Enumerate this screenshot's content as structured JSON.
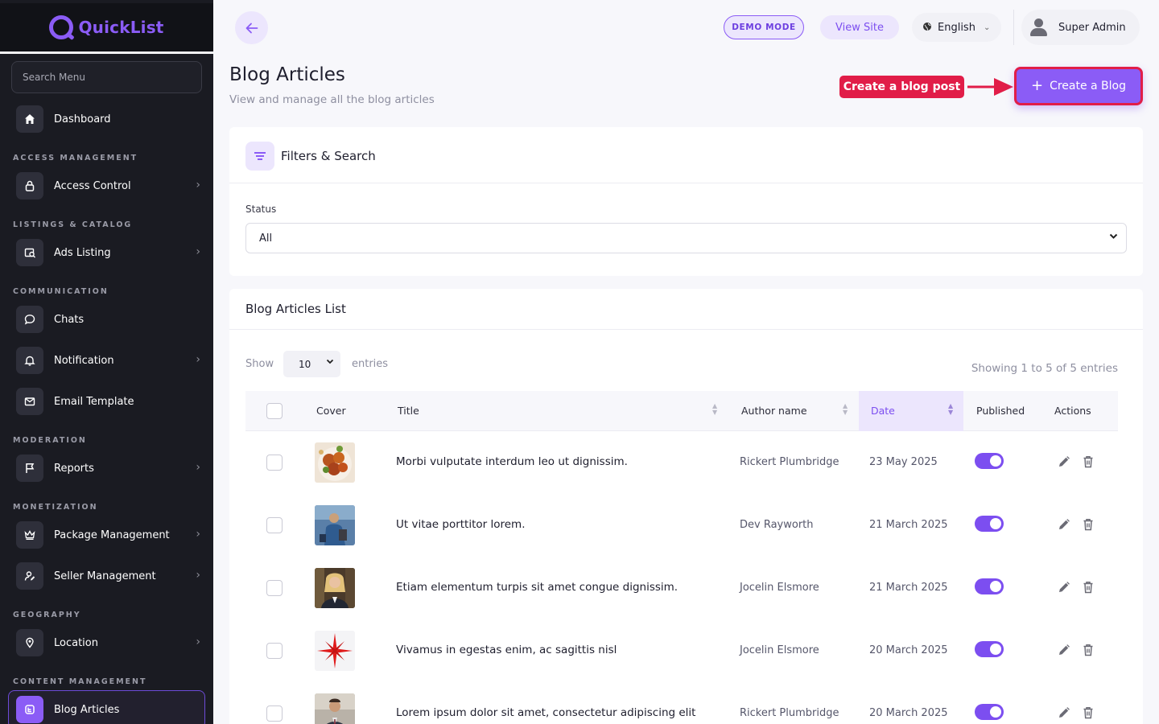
{
  "brand": {
    "name": "QuickList",
    "accent": "#8b5cf6"
  },
  "sidebar": {
    "search_placeholder": "Search Menu",
    "items": [
      {
        "label": "Dashboard",
        "icon": "home-icon"
      },
      {
        "section": "ACCESS MANAGEMENT"
      },
      {
        "label": "Access Control",
        "icon": "lock-icon"
      },
      {
        "section": "LISTINGS & CATALOG"
      },
      {
        "label": "Ads Listing",
        "icon": "ad-search-icon"
      },
      {
        "section": "COMMUNICATION"
      },
      {
        "label": "Chats",
        "icon": "chat-icon"
      },
      {
        "label": "Notification",
        "icon": "bell-icon"
      },
      {
        "label": "Email Template",
        "icon": "mail-icon"
      },
      {
        "section": "MODERATION"
      },
      {
        "label": "Reports",
        "icon": "flag-icon"
      },
      {
        "section": "MONETIZATION"
      },
      {
        "label": "Package Management",
        "icon": "crown-icon"
      },
      {
        "label": "Seller Management",
        "icon": "user-edit-icon"
      },
      {
        "section": "GEOGRAPHY"
      },
      {
        "label": "Location",
        "icon": "map-pin-icon"
      },
      {
        "section": "CONTENT MANAGEMENT"
      },
      {
        "label": "Blog Articles",
        "icon": "blog-icon",
        "active": true
      }
    ]
  },
  "topbar": {
    "demo_mode": "DEMO MODE",
    "view_site": "View Site",
    "language": "English",
    "user": "Super Admin"
  },
  "page": {
    "title": "Blog Articles",
    "subtitle": "View and manage all the blog articles",
    "callout": "Create a blog post",
    "create_button": "Create a Blog"
  },
  "filters": {
    "title": "Filters & Search",
    "status_label": "Status",
    "status_value": "All"
  },
  "list": {
    "title": "Blog Articles List",
    "show_label": "Show",
    "page_size": "10",
    "entries_label": "entries",
    "showing": "Showing 1 to 5 of 5 entries",
    "columns": [
      "Cover",
      "Title",
      "Author name",
      "Date",
      "Published",
      "Actions"
    ],
    "rows": [
      {
        "title": "Morbi vulputate interdum leo ut dignissim.",
        "author": "Rickert Plumbridge",
        "date": "23 May 2025",
        "published": true
      },
      {
        "title": "Ut vitae porttitor lorem.",
        "author": "Dev Rayworth",
        "date": "21 March 2025",
        "published": true
      },
      {
        "title": "Etiam elementum turpis sit amet congue dignissim.",
        "author": "Jocelin Elsmore",
        "date": "21 March 2025",
        "published": true
      },
      {
        "title": "Vivamus in egestas enim, ac sagittis nisl",
        "author": "Jocelin Elsmore",
        "date": "20 March 2025",
        "published": true
      },
      {
        "title": "Lorem ipsum dolor sit amet, consectetur adipiscing elit",
        "author": "Rickert Plumbridge",
        "date": "20 March 2025",
        "published": true
      }
    ]
  },
  "colors": {
    "accent": "#8b5cf6",
    "callout": "#e11d48",
    "sidebar_bg": "#1a1b22"
  }
}
